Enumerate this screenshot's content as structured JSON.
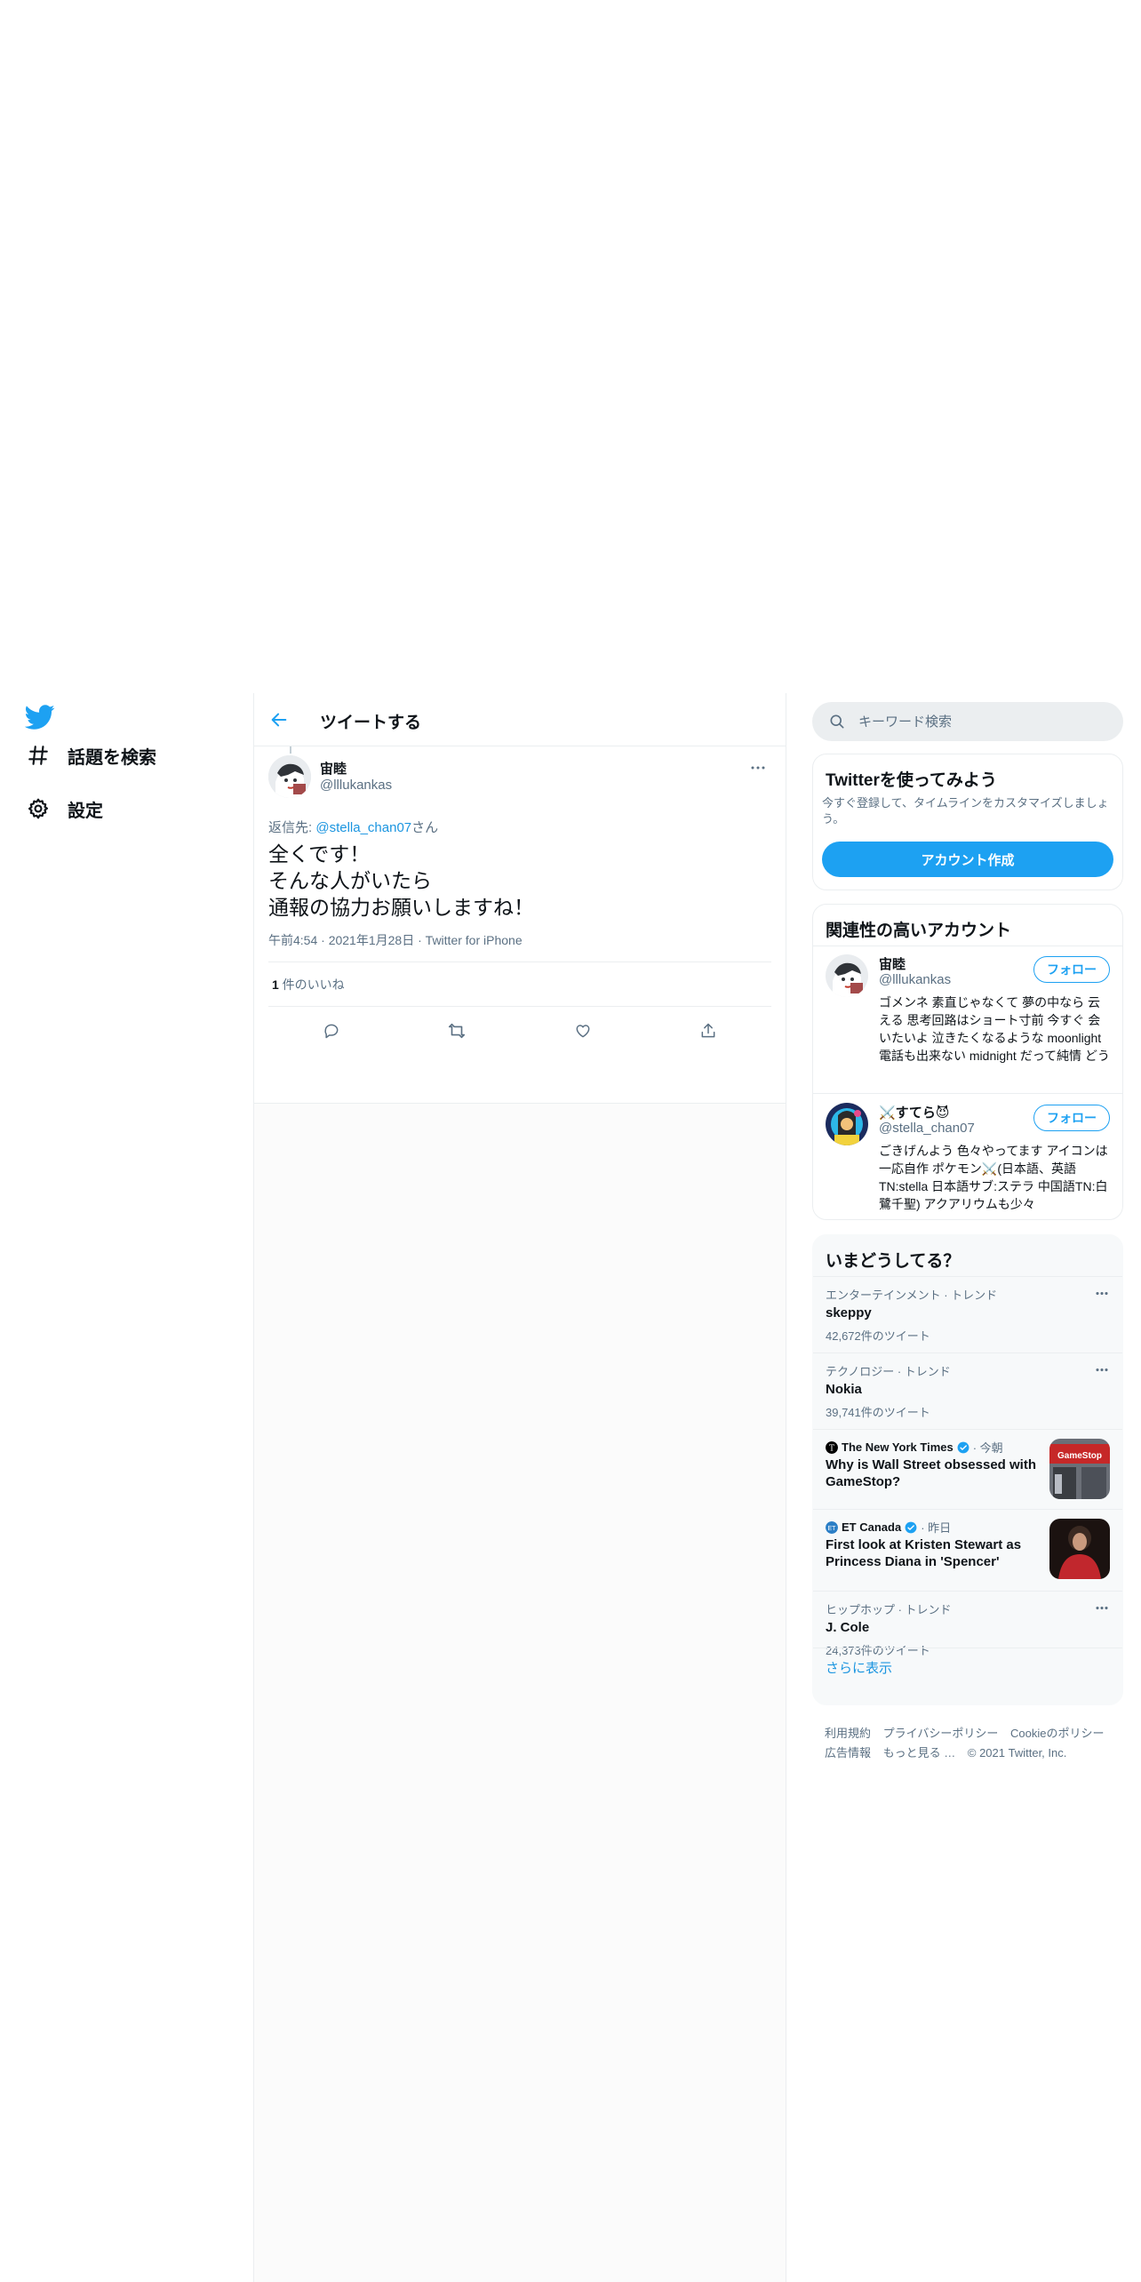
{
  "nav": {
    "logo_icon": "twitter-bird-icon",
    "explore_label": "話題を検索",
    "settings_label": "設定"
  },
  "header": {
    "title": "ツイートする"
  },
  "tweet": {
    "author_name": "宙睦",
    "author_handle": "@lllukankas",
    "reply_prefix": "返信先: ",
    "reply_handle": "@stella_chan07",
    "reply_suffix": "さん",
    "body_lines": [
      "全くです！",
      "そんな人がいたら",
      "通報の協力お願いしますね！"
    ],
    "time": "午前4:54",
    "date": "2021年1月28日",
    "source": "Twitter for iPhone",
    "likes_count": "1",
    "likes_label": " 件のいいね"
  },
  "search": {
    "placeholder": "キーワード検索"
  },
  "signup": {
    "title": "Twitterを使ってみよう",
    "description": "今すぐ登録して、タイムラインをカスタマイズしましょう。",
    "button_label": "アカウント作成"
  },
  "relevant": {
    "title": "関連性の高いアカウント",
    "accounts": [
      {
        "name": "宙睦",
        "handle": "@lllukankas",
        "bio": "ゴメンネ 素直じゃなくて 夢の中なら 云える 思考回路はショート寸前 今すぐ 会いたいよ 泣きたくなるような moonlight 電話も出来ない midnight だって純情 どうしよう ハートは万華鏡",
        "follow_label": "フォロー"
      },
      {
        "name": "⚔️すてら😈",
        "handle": "@stella_chan07",
        "bio": "ごきげんよう 色々やってます アイコンは一応自作 ポケモン⚔️(日本語、英語TN:stella 日本語サブ:ステラ 中国語TN:白鷺千聖) アクアリウムも少々",
        "follow_label": "フォロー"
      }
    ]
  },
  "trends": {
    "title": "いまどうしてる？",
    "items": [
      {
        "context": "エンターテインメント · トレンド",
        "name": "skeppy",
        "count": "42,672件のツイート"
      },
      {
        "context": "テクノロジー · トレンド",
        "name": "Nokia",
        "count": "39,741件のツイート"
      },
      {
        "context": "ヒップホップ · トレンド",
        "name": "J. Cole",
        "count": "24,373件のツイート"
      }
    ],
    "news": [
      {
        "source": "The New York Times",
        "time": "· 今朝",
        "headline": "Why is Wall Street obsessed with GameStop?",
        "thumb_text": "GameStop"
      },
      {
        "source": "ET Canada",
        "time": "· 昨日",
        "headline": "First look at Kristen Stewart as Princess Diana in 'Spencer'"
      }
    ],
    "show_more": "さらに表示"
  },
  "footer": {
    "links": [
      "利用規約",
      "プライバシーポリシー",
      "Cookieのポリシー",
      "広告情報",
      "もっと見る …",
      "© 2021 Twitter, Inc."
    ]
  },
  "colors": {
    "accent": "#1da1f2",
    "link": "#1b95e0",
    "secondary_text": "#5b7083",
    "border": "#ebeef0"
  }
}
